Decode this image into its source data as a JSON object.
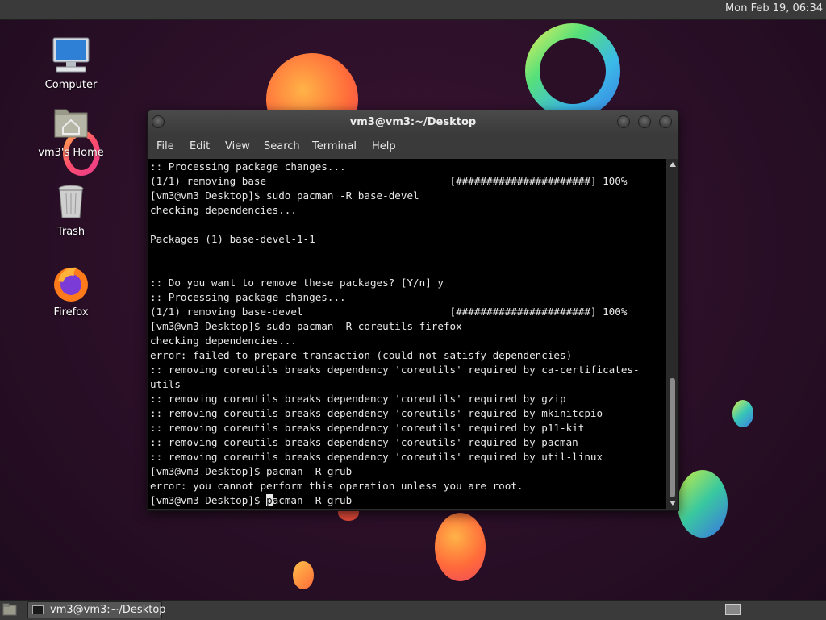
{
  "top_panel": {
    "clock": "Mon Feb 19, 06:34"
  },
  "desktop_icons": [
    {
      "label": "Computer",
      "icon": "computer-icon"
    },
    {
      "label": "vm3's Home",
      "icon": "home-folder-icon"
    },
    {
      "label": "Trash",
      "icon": "trash-icon"
    },
    {
      "label": "Firefox",
      "icon": "firefox-icon"
    }
  ],
  "window": {
    "title": "vm3@vm3:~/Desktop",
    "menu": [
      "File",
      "Edit",
      "View",
      "Search",
      "Terminal",
      "Help"
    ]
  },
  "terminal": {
    "lines": [
      ":: Processing package changes...",
      "(1/1) removing base                              [######################] 100%",
      "[vm3@vm3 Desktop]$ sudo pacman -R base-devel",
      "checking dependencies...",
      "",
      "Packages (1) base-devel-1-1",
      "",
      "",
      ":: Do you want to remove these packages? [Y/n] y",
      ":: Processing package changes...",
      "(1/1) removing base-devel                        [######################] 100%",
      "[vm3@vm3 Desktop]$ sudo pacman -R coreutils firefox",
      "checking dependencies...",
      "error: failed to prepare transaction (could not satisfy dependencies)",
      ":: removing coreutils breaks dependency 'coreutils' required by ca-certificates-",
      "utils",
      ":: removing coreutils breaks dependency 'coreutils' required by gzip",
      ":: removing coreutils breaks dependency 'coreutils' required by mkinitcpio",
      ":: removing coreutils breaks dependency 'coreutils' required by p11-kit",
      ":: removing coreutils breaks dependency 'coreutils' required by pacman",
      ":: removing coreutils breaks dependency 'coreutils' required by util-linux",
      "[vm3@vm3 Desktop]$ pacman -R grub",
      "error: you cannot perform this operation unless you are root."
    ],
    "prompt": "[vm3@vm3 Desktop]$ ",
    "cursor_char": "p",
    "input_rest": "acman -R grub"
  },
  "taskbar": {
    "items": [
      {
        "label": "vm3@vm3:~/Desktop",
        "icon": "terminal-icon"
      }
    ]
  },
  "colors": {
    "panel": "#3a3a3a",
    "terminal_bg": "#000000",
    "terminal_fg": "#e8e8e8",
    "wallpaper": "#2a0f27"
  }
}
